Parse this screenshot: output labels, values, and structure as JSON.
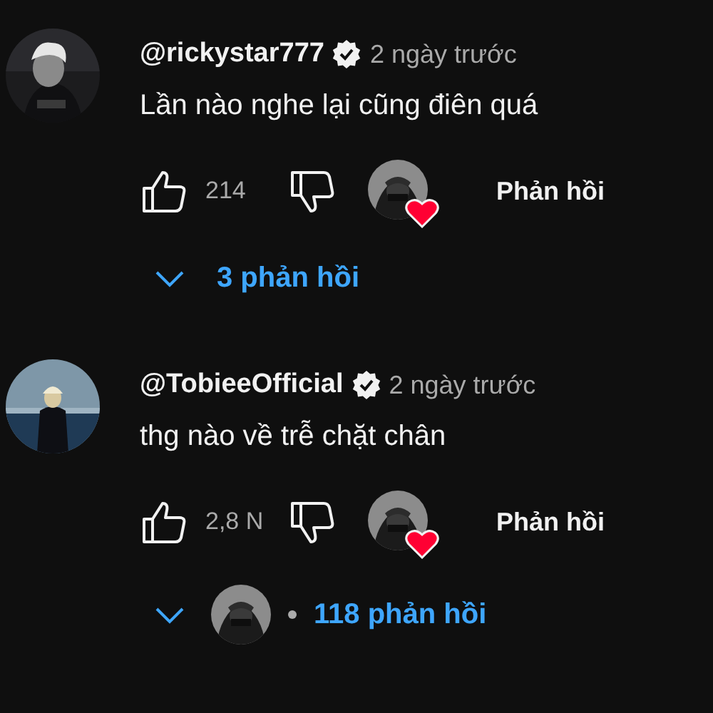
{
  "comments": [
    {
      "author": "@rickystar777",
      "verified": true,
      "time": "2 ngày trước",
      "text": "Lần nào nghe lại cũng điên quá",
      "likes": "214",
      "hearted": true,
      "reply_button": "Phản hồi",
      "replies": {
        "label": "3 phản hồi",
        "with_avatar": false
      }
    },
    {
      "author": "@TobieeOfficial",
      "verified": true,
      "time": "2 ngày trước",
      "text": "thg nào về trễ chặt chân",
      "likes": "2,8 N",
      "hearted": true,
      "reply_button": "Phản hồi",
      "replies": {
        "label": "118 phản hồi",
        "with_avatar": true
      }
    }
  ]
}
